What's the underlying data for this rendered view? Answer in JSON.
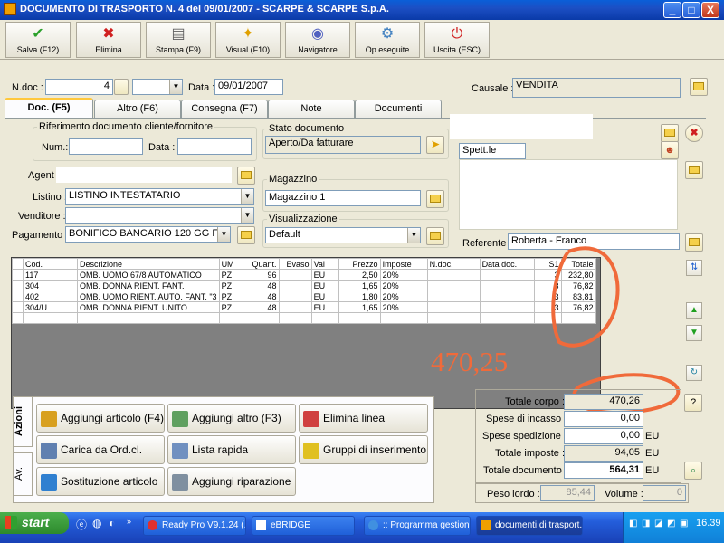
{
  "window": {
    "title": "DOCUMENTO DI TRASPORTO N. 4  del 09/01/2007 - SCARPE & SCARPE S.p.A.",
    "min": "_",
    "max": "□",
    "close": "X"
  },
  "toolbar": [
    {
      "label": "Salva (F12)",
      "icon": "check-icon",
      "color": "#2aa02a",
      "glyph": "✔"
    },
    {
      "label": "Elimina",
      "icon": "delete-x-icon",
      "color": "#d02020",
      "glyph": "✖"
    },
    {
      "label": "Stampa (F9)",
      "icon": "printer-icon",
      "color": "#606060",
      "glyph": "▤"
    },
    {
      "label": "Visual (F10)",
      "icon": "magic-wand-icon",
      "color": "#e0a000",
      "glyph": "✦"
    },
    {
      "label": "Navigatore",
      "icon": "navigator-icon",
      "color": "#5060c0",
      "glyph": "◉"
    },
    {
      "label": "Op.eseguite",
      "icon": "gears-icon",
      "color": "#4080c0",
      "glyph": "⚙"
    },
    {
      "label": "Uscita (ESC)",
      "icon": "exit-icon",
      "color": "#d02020",
      "glyph": "⏻"
    }
  ],
  "header": {
    "ndoc_label": "N.doc :",
    "ndoc_value": "4",
    "data_label": "Data :",
    "data_value": "09/01/2007",
    "causale_label": "Causale :",
    "causale_value": "VENDITA"
  },
  "tabs": [
    "Doc. (F5)",
    "Altro (F6)",
    "Consegna (F7)",
    "Note",
    "Documenti"
  ],
  "doc": {
    "rif_legend": "Riferimento documento cliente/fornitore",
    "num_label": "Num.:",
    "data_label": "Data :",
    "agente_label": "Agent",
    "listino_label": "Listino :",
    "listino_value": "LISTINO INTESTATARIO",
    "venditore_label": "Venditore :",
    "pagamento_label": "Pagamento :",
    "pagamento_value": "BONIFICO BANCARIO 120 GG F.M. +",
    "stato_legend": "Stato documento",
    "stato_value": "Aperto/Da fatturare",
    "magazzino_legend": "Magazzino",
    "magazzino_value": "Magazzino 1",
    "visual_legend": "Visualizzazione",
    "visual_value": "Default",
    "spett_label": "Spett.le",
    "referente_label": "Referente",
    "referente_value": "Roberta - Franco"
  },
  "grid": {
    "headers": [
      "",
      "Cod.",
      "Descrizione",
      "UM",
      "Quant.",
      "Evaso",
      "Val",
      "Prezzo",
      "Imposte",
      "N.doc.",
      "Data doc.",
      "S1",
      "Totale"
    ],
    "rows": [
      [
        "",
        "117",
        "OMB. UOMO 67/8 AUTOMATICO",
        "PZ",
        "96",
        "",
        "EU",
        "2,50",
        "20%",
        "",
        "",
        "3",
        "232,80"
      ],
      [
        "",
        "304",
        "OMB. DONNA RIENT. FANT.",
        "PZ",
        "48",
        "",
        "EU",
        "1,65",
        "20%",
        "",
        "",
        "3",
        "76,82"
      ],
      [
        "",
        "402",
        "OMB. UOMO RIENT. AUTO. FANT. \"3",
        "PZ",
        "48",
        "",
        "EU",
        "1,80",
        "20%",
        "",
        "",
        "3",
        "83,81"
      ],
      [
        "",
        "304/U",
        "OMB. DONNA RIENT. UNITO",
        "PZ",
        "48",
        "",
        "EU",
        "1,65",
        "20%",
        "",
        "",
        "3",
        "76,82"
      ],
      [
        "",
        "",
        "",
        "",
        "",
        "",
        "",
        "",
        "",
        "",
        "",
        "",
        ""
      ]
    ]
  },
  "annotation": {
    "value": "470,25",
    "color": "#f06a3a"
  },
  "azioni": {
    "tab1": "Azioni",
    "tab2": "Av.",
    "buttons": [
      {
        "label": "Aggiungi articolo (F4)",
        "icon": "box-add-icon",
        "color": "#d8a020"
      },
      {
        "label": "Aggiungi altro (F3)",
        "icon": "grid-add-icon",
        "color": "#60a060"
      },
      {
        "label": "Elimina linea",
        "icon": "grid-delete-icon",
        "color": "#d04040"
      },
      {
        "label": "Carica da Ord.cl.",
        "icon": "order-icon",
        "color": "#6080b0"
      },
      {
        "label": "Lista rapida",
        "icon": "list-icon",
        "color": "#7090c0"
      },
      {
        "label": "Gruppi di inserimento",
        "icon": "star-icon",
        "color": "#e0c020"
      },
      {
        "label": "Sostituzione articolo",
        "icon": "swap-icon",
        "color": "#3080d0"
      },
      {
        "label": "Aggiungi riparazione",
        "icon": "gear-icon",
        "color": "#8090a0"
      }
    ]
  },
  "totals": {
    "corpo_label": "Totale corpo :",
    "corpo_value": "470,26",
    "incasso_label": "Spese di incasso :",
    "incasso_value": "0,00",
    "spedizione_label": "Spese spedizione :",
    "spedizione_value": "0,00",
    "spedizione_unit": "EU",
    "imposte_label": "Totale imposte :",
    "imposte_value": "94,05",
    "imposte_unit": "EU",
    "documento_label": "Totale documento :",
    "documento_value": "564,31",
    "documento_unit": "EU",
    "peso_label": "Peso lordo :",
    "peso_value": "85,44",
    "volume_label": "Volume :",
    "volume_value": "0",
    "help": "?"
  },
  "taskbar": {
    "start": "start",
    "items": [
      "Ready Pro V9.1.24 (...",
      "eBRIDGE",
      ":: Programma gestion...",
      "documenti di trasport..."
    ],
    "clock": "16.39"
  }
}
